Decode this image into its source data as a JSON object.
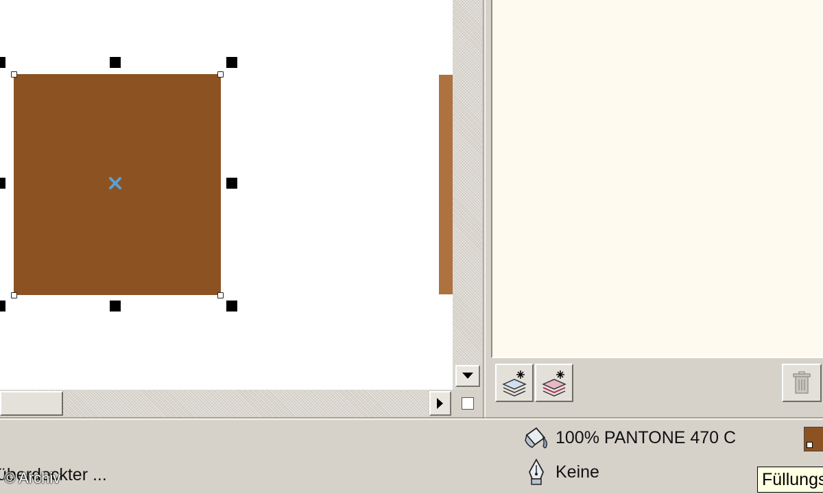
{
  "colors": {
    "fill": "#8c5221",
    "shadow": "#ae7140",
    "canvas": "#ffffff",
    "panel": "#fffaf0",
    "chrome": "#d6d2ca",
    "center_marker": "#5aa0d8",
    "tooltip_bg": "#ffffe1"
  },
  "icons": {
    "vscroll_down": "triangle-down-icon",
    "hscroll_right": "triangle-right-icon",
    "new_layer": "new-layer-icon",
    "new_master_layer": "new-master-layer-icon",
    "delete": "trash-icon",
    "fill": "fill-bucket-icon",
    "outline": "pen-nib-icon"
  },
  "status": {
    "object_info": "überdeckter ...",
    "fill_info": "100% PANTONE 470 C",
    "outline_info": "Keine",
    "tooltip": "Füllungs"
  },
  "watermark": "© Archiv"
}
